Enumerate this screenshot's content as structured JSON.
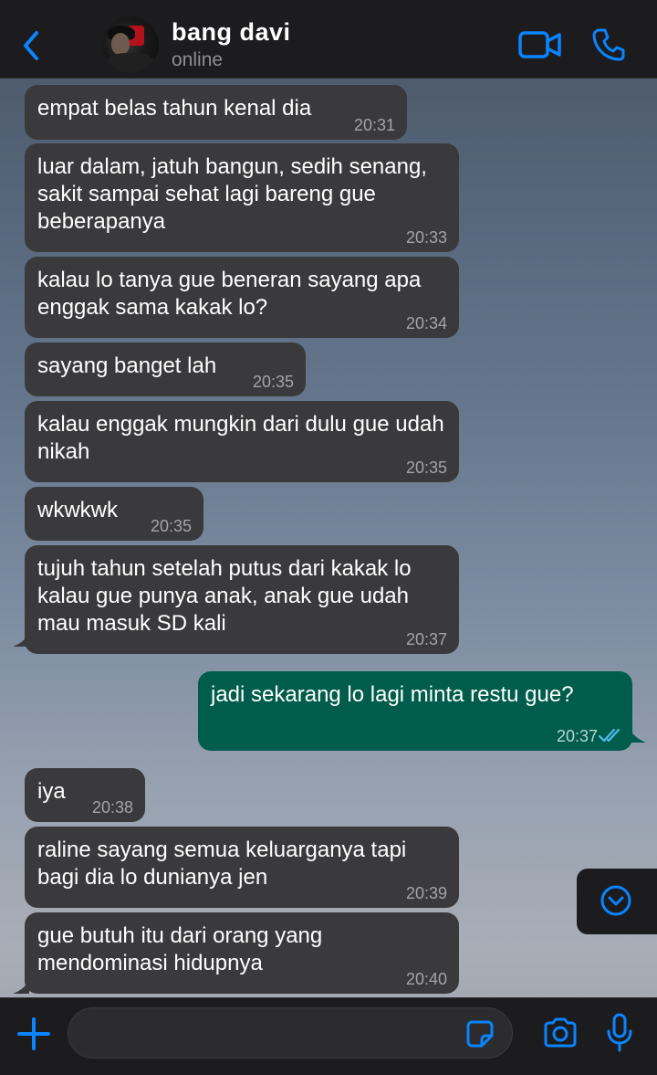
{
  "header": {
    "contact_name": "bang davi",
    "status": "online",
    "icons": [
      "back-chevron-icon",
      "avatar",
      "video-call-icon",
      "phone-call-icon"
    ]
  },
  "messages": [
    {
      "direction": "incoming",
      "text": "empat belas tahun kenal dia",
      "time": "20:31"
    },
    {
      "direction": "incoming",
      "text": "luar dalam, jatuh bangun, sedih senang, sakit sampai sehat lagi bareng gue beberapanya",
      "time": "20:33"
    },
    {
      "direction": "incoming",
      "text": "kalau lo tanya gue beneran sayang apa enggak sama kakak lo?",
      "time": "20:34"
    },
    {
      "direction": "incoming",
      "text": "sayang banget lah",
      "time": "20:35"
    },
    {
      "direction": "incoming",
      "text": "kalau enggak mungkin dari dulu gue udah nikah",
      "time": "20:35"
    },
    {
      "direction": "incoming",
      "text": "wkwkwk",
      "time": "20:35"
    },
    {
      "direction": "incoming",
      "text": "tujuh tahun setelah putus dari kakak lo kalau gue punya anak, anak gue udah mau masuk SD kali",
      "time": "20:37"
    },
    {
      "direction": "outgoing",
      "text": "jadi sekarang lo lagi minta restu gue?",
      "time": "20:37",
      "status": "read"
    },
    {
      "direction": "incoming",
      "text": "iya",
      "time": "20:38"
    },
    {
      "direction": "incoming",
      "text": "raline sayang semua keluarganya tapi bagi dia lo dunianya jen",
      "time": "20:39"
    },
    {
      "direction": "incoming",
      "text": "gue butuh itu dari orang yang mendominasi hidupnya",
      "time": "20:40"
    }
  ],
  "composer": {
    "value": "",
    "icons": [
      "plus-icon",
      "sticker-icon",
      "camera-icon",
      "microphone-icon"
    ]
  },
  "colors": {
    "header_bg": "#1c1c1e",
    "incoming_bubble": "#3a3a3c",
    "outgoing_bubble": "#005c4b",
    "accent_blue": "#0a84ff",
    "read_ticks": "#53bdeb"
  }
}
